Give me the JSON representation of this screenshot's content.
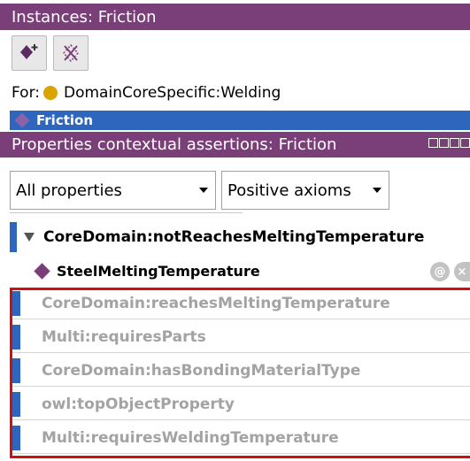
{
  "instances_panel": {
    "title": "Instances: Friction",
    "toolbar": {
      "add_icon": "add-individual-icon",
      "delete_icon": "delete-individual-icon"
    },
    "for_label": "For:",
    "for_value": "DomainCoreSpecific:Welding",
    "selected_instance": "Friction"
  },
  "properties_panel": {
    "title": "Properties contextual assertions: Friction",
    "property_filter": "All properties",
    "axiom_filter": "Positive axioms",
    "group": {
      "label": "CoreDomain:notReachesMeltingTemperature",
      "value": "SteelMeltingTemperature",
      "annotate_label": "@",
      "remove_label": "×"
    },
    "other_properties": [
      "CoreDomain:reachesMeltingTemperature",
      "Multi:requiresParts",
      "CoreDomain:hasBondingMaterialType",
      "owl:topObjectProperty",
      "Multi:requiresWeldingTemperature"
    ]
  },
  "colors": {
    "header_bg": "#7a3e78",
    "selection": "#2e65bd",
    "highlight_border": "#d01010",
    "disabled_text": "#a3a3a3"
  }
}
